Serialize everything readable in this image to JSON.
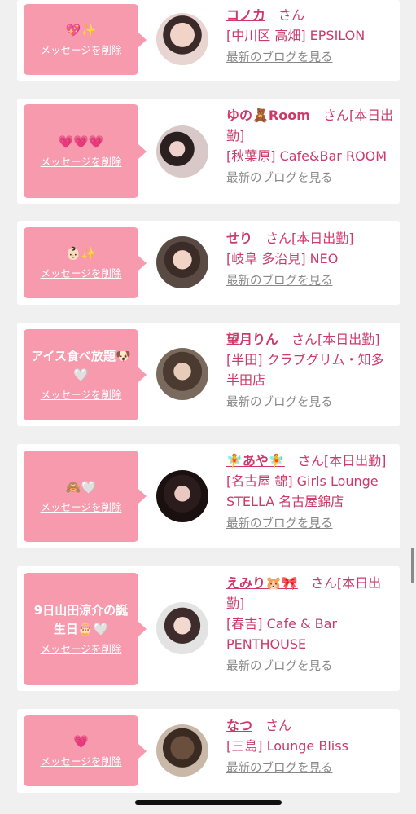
{
  "delete_label": "メッセージを削除",
  "san_label": "さん",
  "blog_label": "最新のブログを見る",
  "cards": [
    {
      "message": "💖✨",
      "name": "コノカ",
      "status": "",
      "shop": "[中川区 高畑] EPSILON"
    },
    {
      "message": "💗💗💗",
      "name": "ゆの🧸Room",
      "status": "[本日出勤]",
      "shop": "[秋葉原] Cafe&Bar ROOM"
    },
    {
      "message": "👶🏻✨",
      "name": "せり",
      "status": "[本日出勤]",
      "shop": "[岐阜 多治見] NEO"
    },
    {
      "message": "アイス食べ放題🐶🤍",
      "name": "望月りん",
      "status": "[本日出勤]",
      "shop": "[半田] クラブグリム・知多半田店"
    },
    {
      "message": "🙈🤍",
      "name": "🧚あや🧚",
      "status": "[本日出勤]",
      "shop": "[名古屋 錦] Girls Lounge STELLA 名古屋錦店"
    },
    {
      "message": "9日山田涼介の誕生日🎂🤍",
      "name": "えみり🐹🎀",
      "status": "[本日出勤]",
      "shop": "[春吉] Cafe & Bar PENTHOUSE"
    },
    {
      "message": "💗",
      "name": "なつ",
      "status": "",
      "shop": "[三島] Lounge Bliss"
    }
  ],
  "colors": {
    "accent": "#cd3a6a",
    "bubble": "#f79aad",
    "background": "#f0f0f0"
  }
}
